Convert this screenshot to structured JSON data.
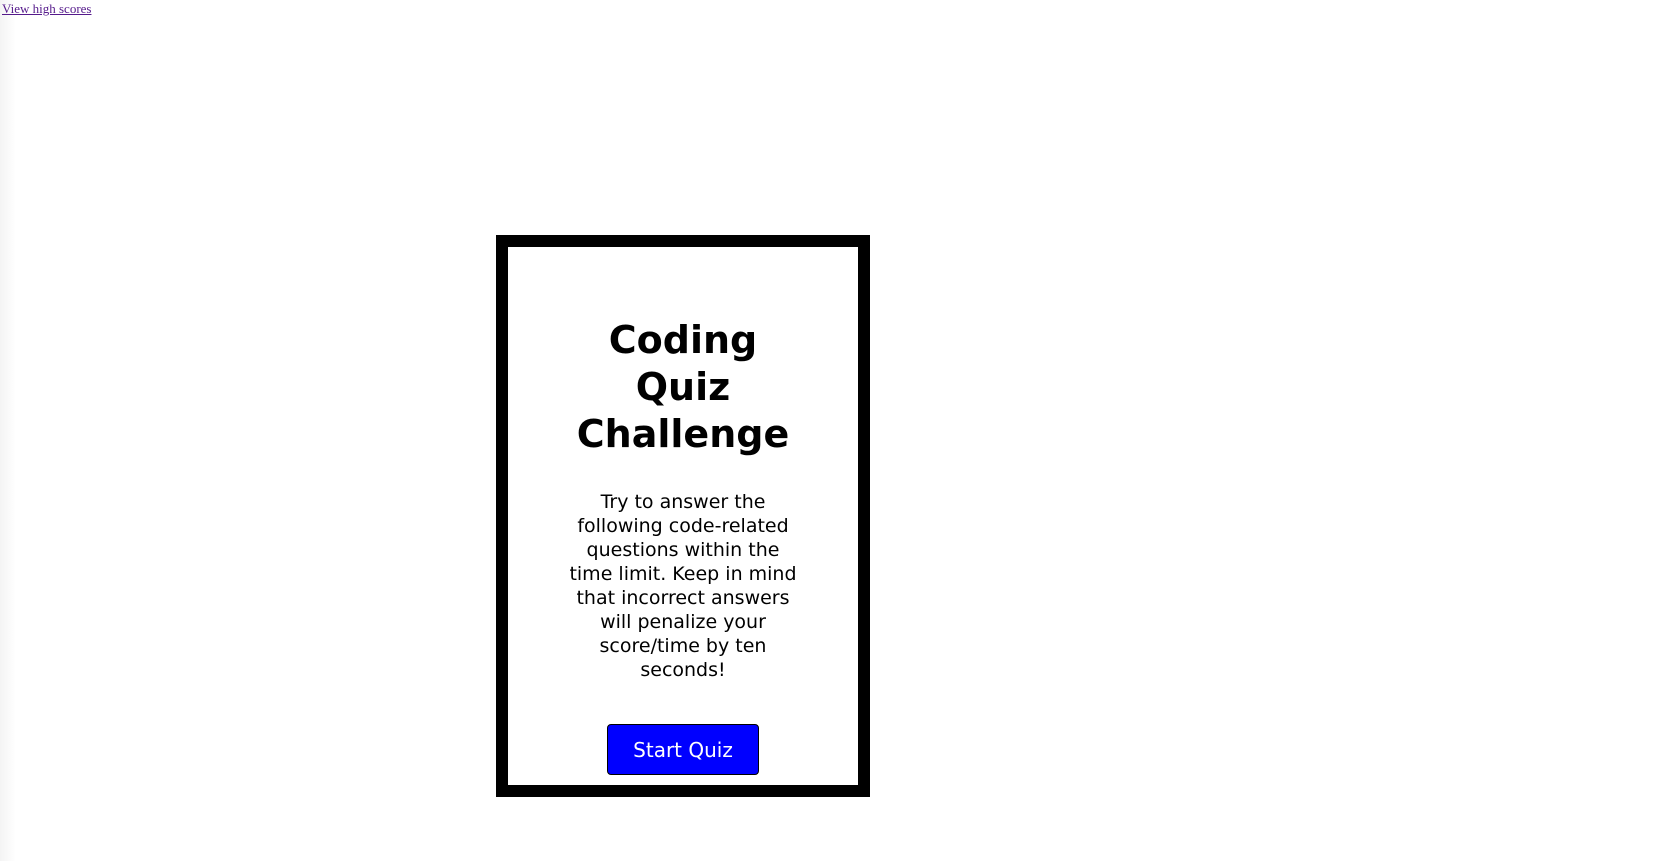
{
  "header": {
    "high_scores_link": "View high scores"
  },
  "quiz": {
    "title": "Coding Quiz Challenge",
    "description": "Try to answer the following code-related questions within the time limit. Keep in mind that incorrect answers will penalize your score/time by ten seconds!",
    "start_button_label": "Start Quiz"
  },
  "colors": {
    "button_background": "#0000ff",
    "button_text": "#ffffff",
    "card_border": "#000000",
    "link": "#551a8b"
  }
}
